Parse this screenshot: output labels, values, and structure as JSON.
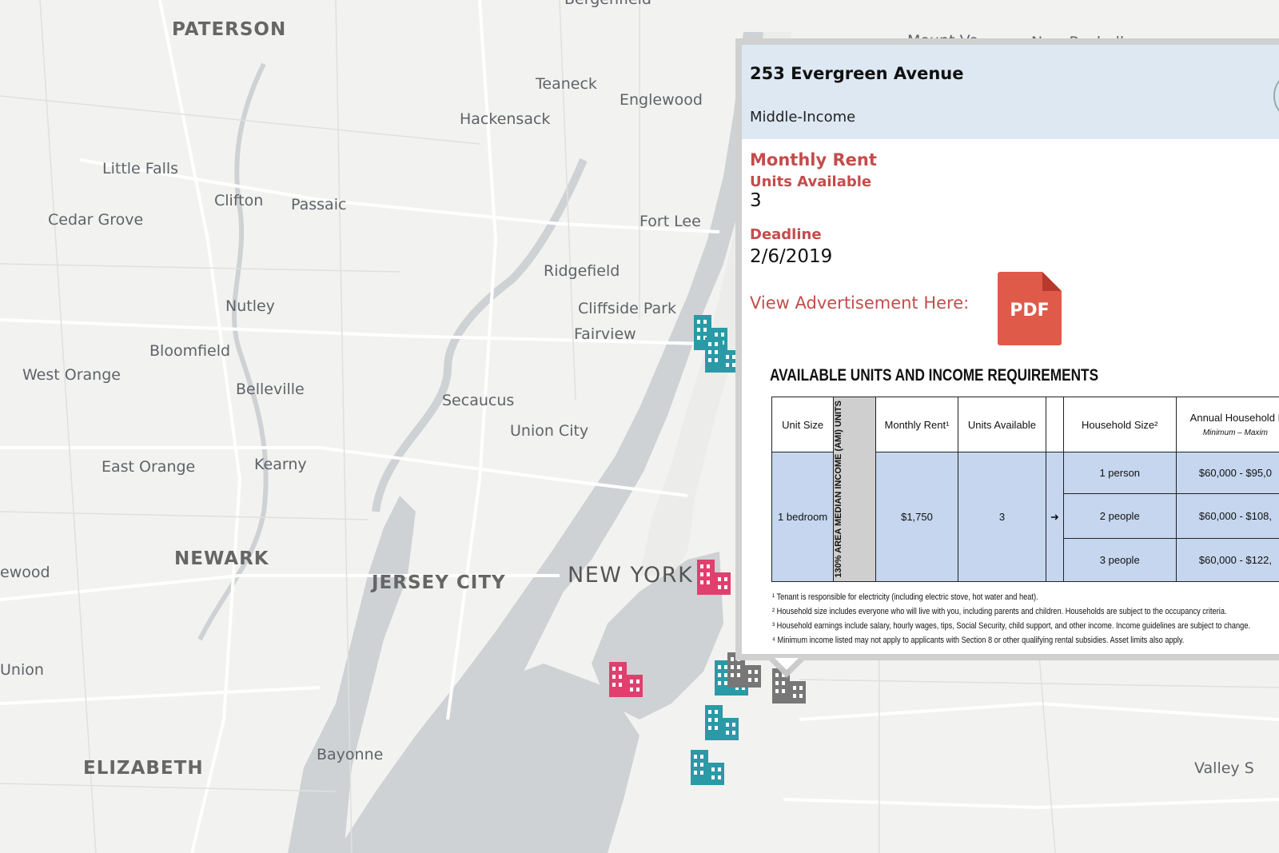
{
  "map": {
    "labels": [
      {
        "text": "PATERSON",
        "cls": "big"
      },
      {
        "text": "Teaneck",
        "cls": "small"
      },
      {
        "text": "Englewood",
        "cls": "small"
      },
      {
        "text": "Hackensack",
        "cls": "small"
      },
      {
        "text": "Little Falls",
        "cls": "small"
      },
      {
        "text": "Clifton",
        "cls": "small"
      },
      {
        "text": "Passaic",
        "cls": "small"
      },
      {
        "text": "Cedar Grove",
        "cls": "small"
      },
      {
        "text": "Fort Lee",
        "cls": "small"
      },
      {
        "text": "Ridgefield",
        "cls": "small"
      },
      {
        "text": "Nutley",
        "cls": "small"
      },
      {
        "text": "Cliffside Park",
        "cls": "small"
      },
      {
        "text": "Fairview",
        "cls": "small"
      },
      {
        "text": "Bloomfield",
        "cls": "small"
      },
      {
        "text": "West Orange",
        "cls": "small"
      },
      {
        "text": "Belleville",
        "cls": "small"
      },
      {
        "text": "Secaucus",
        "cls": "small"
      },
      {
        "text": "Union City",
        "cls": "small"
      },
      {
        "text": "East Orange",
        "cls": "small"
      },
      {
        "text": "Kearny",
        "cls": "small"
      },
      {
        "text": "NEWARK",
        "cls": "big"
      },
      {
        "text": "JERSEY CITY",
        "cls": "big"
      },
      {
        "text": "NEW YORK",
        "cls": "huge"
      },
      {
        "text": "ewood",
        "cls": "small"
      },
      {
        "text": "Union",
        "cls": "small"
      },
      {
        "text": "ELIZABETH",
        "cls": "big"
      },
      {
        "text": "Bayonne",
        "cls": "small"
      },
      {
        "text": "Valley S",
        "cls": "small"
      },
      {
        "text": "Bergenfield",
        "cls": "small"
      },
      {
        "text": "Mount Ve",
        "cls": "small"
      },
      {
        "text": "New Rochelle",
        "cls": "small"
      }
    ],
    "markers": [
      {
        "type": "teal",
        "icon": "building-icon"
      },
      {
        "type": "teal",
        "icon": "building-icon"
      },
      {
        "type": "pink",
        "icon": "building-icon"
      },
      {
        "type": "pink",
        "icon": "building-icon"
      },
      {
        "type": "teal",
        "icon": "building-icon"
      },
      {
        "type": "gray",
        "icon": "building-icon"
      },
      {
        "type": "gray",
        "icon": "building-icon"
      },
      {
        "type": "teal",
        "icon": "building-icon"
      },
      {
        "type": "teal",
        "icon": "building-icon"
      }
    ],
    "colors": {
      "teal": "#2a9aa6",
      "pink": "#e0406e",
      "gray": "#777777",
      "water": "#cfd2d4",
      "land": "#f2f2f0"
    }
  },
  "popup": {
    "title": "253 Evergreen Avenue",
    "subtitle": "Middle-Income",
    "monthly_rent_label": "Monthly Rent",
    "units_label": "Units Available",
    "units_value": "3",
    "deadline_label": "Deadline",
    "deadline_value": "2/6/2019",
    "ad_label": "View Advertisement Here:",
    "pdf_label": "PDF",
    "pdf_icon": "pdf-icon",
    "requirements": {
      "title": "AVAILABLE UNITS AND INCOME REQUIREMENTS",
      "headers": {
        "unit_size": "Unit Size",
        "monthly_rent": "Monthly Rent¹",
        "units_available": "Units Available",
        "household_size": "Household Size²",
        "annual_income": "Annual Household I",
        "annual_income_sub": "Minimum – Maxim"
      },
      "ami": "130% AREA MEDIAN INCOME (AMI) UNITS",
      "row": {
        "unit_size": "1 bedroom",
        "rent": "$1,750",
        "units": "3",
        "arrow": "➜"
      },
      "households": [
        {
          "size": "1 person",
          "income": "$60,000 - $95,0"
        },
        {
          "size": "2 people",
          "income": "$60,000 - $108,"
        },
        {
          "size": "3 people",
          "income": "$60,000 - $122,"
        }
      ],
      "footnotes": [
        "¹ Tenant is responsible for electricity (including electric stove, hot water and heat).",
        "² Household size includes everyone who will live with you, including parents and children. Households are subject to the occupancy criteria.",
        "³ Household earnings include salary, hourly wages, tips, Social Security, child support, and other income. Income guidelines are subject to change.",
        "⁴ Minimum income listed may not apply to applicants with Section 8 or other qualifying rental subsidies. Asset limits also apply."
      ]
    }
  }
}
